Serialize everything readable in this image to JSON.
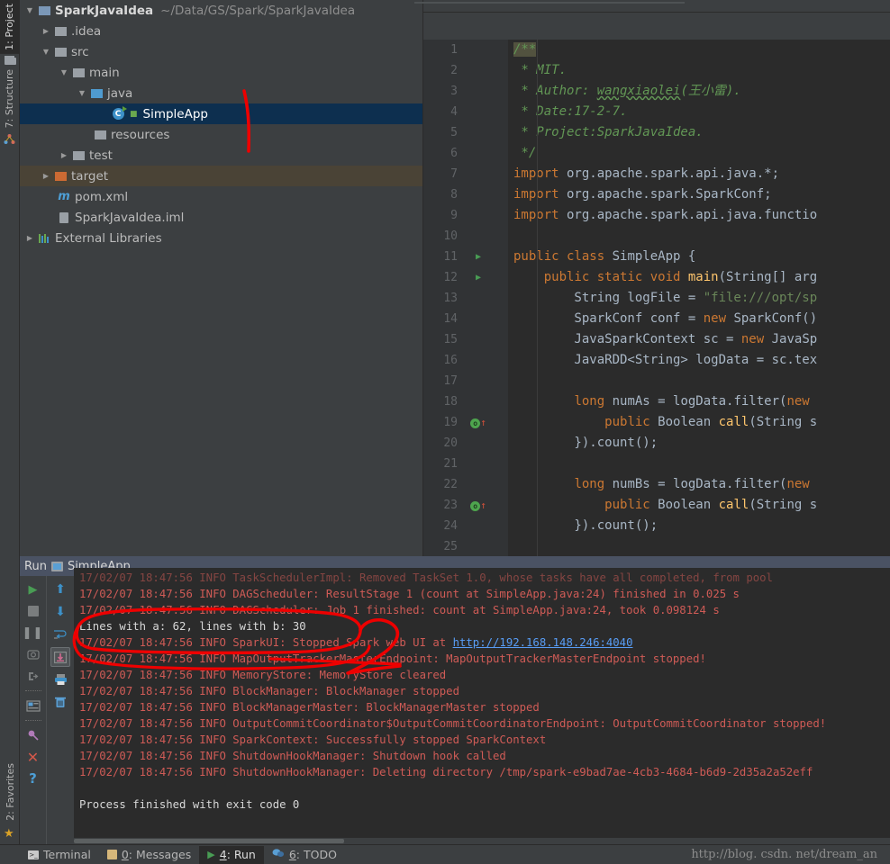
{
  "toolwindows": {
    "left": [
      {
        "label": "1: Project",
        "prefix": "1",
        "icon": "project-icon",
        "active": true
      },
      {
        "label": "7: Structure",
        "prefix": "7",
        "icon": "structure-icon",
        "active": false
      },
      {
        "label": "2: Favorites",
        "prefix": "2",
        "icon": "star-icon",
        "active": false
      }
    ]
  },
  "project_tree": {
    "root": {
      "name": "SparkJavaIdea",
      "path": "~/Data/GS/Spark/SparkJavaIdea"
    },
    "rows": [
      {
        "label": "SparkJavaIdea",
        "detail": "~/Data/GS/Spark/SparkJavaIdea",
        "depth": 0,
        "arrow": "down",
        "icon": "module-folder-icon",
        "state": "normal"
      },
      {
        "label": ".idea",
        "detail": "",
        "depth": 1,
        "arrow": "right",
        "icon": "folder-icon",
        "state": "normal"
      },
      {
        "label": "src",
        "detail": "",
        "depth": 1,
        "arrow": "down",
        "icon": "folder-icon",
        "state": "normal"
      },
      {
        "label": "main",
        "detail": "",
        "depth": 2,
        "arrow": "down",
        "icon": "folder-icon",
        "state": "normal"
      },
      {
        "label": "java",
        "detail": "",
        "depth": 3,
        "arrow": "down",
        "icon": "source-folder-icon",
        "state": "normal"
      },
      {
        "label": "SimpleApp",
        "detail": "",
        "depth": 4,
        "arrow": "none",
        "icon": "java-class-icon",
        "state": "selected"
      },
      {
        "label": "resources",
        "detail": "",
        "depth": 3,
        "arrow": "none",
        "icon": "resources-folder-icon",
        "state": "normal"
      },
      {
        "label": "test",
        "detail": "",
        "depth": 2,
        "arrow": "right",
        "icon": "folder-icon",
        "state": "normal"
      },
      {
        "label": "target",
        "detail": "",
        "depth": 1,
        "arrow": "right",
        "icon": "excluded-folder-icon",
        "state": "highlight"
      },
      {
        "label": "pom.xml",
        "detail": "",
        "depth": 1,
        "arrow": "none",
        "icon": "maven-icon",
        "state": "normal"
      },
      {
        "label": "SparkJavaIdea.iml",
        "detail": "",
        "depth": 1,
        "arrow": "none",
        "icon": "iml-icon",
        "state": "normal"
      },
      {
        "label": "External Libraries",
        "detail": "",
        "depth": 0,
        "arrow": "right",
        "icon": "libraries-icon",
        "state": "normal"
      }
    ]
  },
  "editor": {
    "lines": [
      {
        "n": "1",
        "fold": "top",
        "gutter": "",
        "segments": [
          {
            "t": "/**",
            "c": "c-cmt-hl"
          }
        ]
      },
      {
        "n": "2",
        "fold": "",
        "gutter": "",
        "segments": [
          {
            "t": " * MIT.",
            "c": "c-cmt"
          }
        ]
      },
      {
        "n": "3",
        "fold": "",
        "gutter": "",
        "segments": [
          {
            "t": " * Author: ",
            "c": "c-cmt"
          },
          {
            "t": "wangxiaolei",
            "c": "c-cmt-u"
          },
          {
            "t": "(王小雷).",
            "c": "c-cmt"
          }
        ]
      },
      {
        "n": "4",
        "fold": "",
        "gutter": "",
        "segments": [
          {
            "t": " * Date:17-2-7.",
            "c": "c-cmt"
          }
        ]
      },
      {
        "n": "5",
        "fold": "",
        "gutter": "",
        "segments": [
          {
            "t": " * Project:SparkJavaIdea.",
            "c": "c-cmt"
          }
        ]
      },
      {
        "n": "6",
        "fold": "end",
        "gutter": "",
        "segments": [
          {
            "t": " */",
            "c": "c-cmt"
          }
        ]
      },
      {
        "n": "7",
        "fold": "top",
        "gutter": "",
        "segments": [
          {
            "t": "import",
            "c": "c-kw"
          },
          {
            "t": " org.apache.spark.api.java.*;",
            "c": "c-txt"
          }
        ]
      },
      {
        "n": "8",
        "fold": "",
        "gutter": "",
        "segments": [
          {
            "t": "import",
            "c": "c-kw"
          },
          {
            "t": " org.apache.spark.SparkConf;",
            "c": "c-txt"
          }
        ]
      },
      {
        "n": "9",
        "fold": "end",
        "gutter": "",
        "segments": [
          {
            "t": "import",
            "c": "c-kw"
          },
          {
            "t": " org.apache.spark.api.java.functio",
            "c": "c-txt"
          }
        ]
      },
      {
        "n": "10",
        "fold": "",
        "gutter": "",
        "segments": [
          {
            "t": "",
            "c": "c-txt"
          }
        ]
      },
      {
        "n": "11",
        "fold": "",
        "gutter": "run",
        "segments": [
          {
            "t": "public class",
            "c": "c-kw"
          },
          {
            "t": " SimpleApp {",
            "c": "c-txt"
          }
        ]
      },
      {
        "n": "12",
        "fold": "top",
        "gutter": "run",
        "segments": [
          {
            "t": "    ",
            "c": "c-txt"
          },
          {
            "t": "public static void",
            "c": "c-kw"
          },
          {
            "t": " ",
            "c": "c-txt"
          },
          {
            "t": "main",
            "c": "c-meth"
          },
          {
            "t": "(String[] arg",
            "c": "c-txt"
          }
        ]
      },
      {
        "n": "13",
        "fold": "",
        "gutter": "",
        "segments": [
          {
            "t": "        String logFile = ",
            "c": "c-txt"
          },
          {
            "t": "\"file:///opt/sp",
            "c": "c-str"
          }
        ]
      },
      {
        "n": "14",
        "fold": "",
        "gutter": "",
        "segments": [
          {
            "t": "        SparkConf conf = ",
            "c": "c-txt"
          },
          {
            "t": "new",
            "c": "c-kw"
          },
          {
            "t": " SparkConf()",
            "c": "c-txt"
          }
        ]
      },
      {
        "n": "15",
        "fold": "",
        "gutter": "",
        "segments": [
          {
            "t": "        JavaSparkContext sc = ",
            "c": "c-txt"
          },
          {
            "t": "new",
            "c": "c-kw"
          },
          {
            "t": " JavaSp",
            "c": "c-txt"
          }
        ]
      },
      {
        "n": "16",
        "fold": "",
        "gutter": "",
        "segments": [
          {
            "t": "        JavaRDD<String> logData = sc.tex",
            "c": "c-txt"
          }
        ]
      },
      {
        "n": "17",
        "fold": "",
        "gutter": "",
        "segments": [
          {
            "t": "",
            "c": "c-txt"
          }
        ]
      },
      {
        "n": "18",
        "fold": "top",
        "gutter": "",
        "segments": [
          {
            "t": "        ",
            "c": "c-txt"
          },
          {
            "t": "long",
            "c": "c-kw"
          },
          {
            "t": " numAs = logData.filter(",
            "c": "c-txt"
          },
          {
            "t": "new",
            "c": "c-kw"
          }
        ]
      },
      {
        "n": "19",
        "fold": "bar",
        "gutter": "override",
        "segments": [
          {
            "t": "            ",
            "c": "c-txt"
          },
          {
            "t": "public",
            "c": "c-kw"
          },
          {
            "t": " Boolean ",
            "c": "c-txt"
          },
          {
            "t": "call",
            "c": "c-meth"
          },
          {
            "t": "(String s",
            "c": "c-txt"
          }
        ]
      },
      {
        "n": "20",
        "fold": "end",
        "gutter": "",
        "segments": [
          {
            "t": "        }).count();",
            "c": "c-txt"
          }
        ]
      },
      {
        "n": "21",
        "fold": "",
        "gutter": "",
        "segments": [
          {
            "t": "",
            "c": "c-txt"
          }
        ]
      },
      {
        "n": "22",
        "fold": "top",
        "gutter": "",
        "segments": [
          {
            "t": "        ",
            "c": "c-txt"
          },
          {
            "t": "long",
            "c": "c-kw"
          },
          {
            "t": " numBs = logData.filter(",
            "c": "c-txt"
          },
          {
            "t": "new",
            "c": "c-kw"
          }
        ]
      },
      {
        "n": "23",
        "fold": "bar",
        "gutter": "override",
        "segments": [
          {
            "t": "            ",
            "c": "c-txt"
          },
          {
            "t": "public",
            "c": "c-kw"
          },
          {
            "t": " Boolean ",
            "c": "c-txt"
          },
          {
            "t": "call",
            "c": "c-meth"
          },
          {
            "t": "(String s",
            "c": "c-txt"
          }
        ]
      },
      {
        "n": "24",
        "fold": "end",
        "gutter": "",
        "segments": [
          {
            "t": "        }).count();",
            "c": "c-txt"
          }
        ]
      },
      {
        "n": "25",
        "fold": "",
        "gutter": "",
        "segments": [
          {
            "t": "",
            "c": "c-txt"
          }
        ]
      }
    ]
  },
  "run_panel": {
    "header_title": "Run",
    "header_config": "SimpleApp",
    "toolbar_left": [
      "rerun-icon",
      "stop-icon",
      "pause-icon",
      "dump-threads-icon",
      "resume-icon",
      "toggle-view-icon",
      "pin-icon",
      "close-icon",
      "help-icon"
    ],
    "toolbar_right": [
      "up-icon",
      "down-icon",
      "soft-wrap-icon",
      "scroll-to-end-icon",
      "print-icon",
      "clear-all-icon"
    ],
    "console_lines": [
      {
        "text": "17/02/07 18:47:56 INFO TaskSchedulerImpl: Removed TaskSet 1.0, whose tasks have all completed, from pool",
        "type": "clipped"
      },
      {
        "text": "17/02/07 18:47:56 INFO DAGScheduler: ResultStage 1 (count at SimpleApp.java:24) finished in 0.025 s",
        "type": "err"
      },
      {
        "text": "17/02/07 18:47:56 INFO DAGScheduler: Job 1 finished: count at SimpleApp.java:24, took 0.098124 s",
        "type": "err"
      },
      {
        "text": "Lines with a: 62, lines with b: 30",
        "type": "out"
      },
      {
        "text": "17/02/07 18:47:56 INFO SparkUI: Stopped Spark web UI at ",
        "type": "err",
        "link": "http://192.168.148.246:4040"
      },
      {
        "text": "17/02/07 18:47:56 INFO MapOutputTrackerMasterEndpoint: MapOutputTrackerMasterEndpoint stopped!",
        "type": "err"
      },
      {
        "text": "17/02/07 18:47:56 INFO MemoryStore: MemoryStore cleared",
        "type": "err"
      },
      {
        "text": "17/02/07 18:47:56 INFO BlockManager: BlockManager stopped",
        "type": "err"
      },
      {
        "text": "17/02/07 18:47:56 INFO BlockManagerMaster: BlockManagerMaster stopped",
        "type": "err"
      },
      {
        "text": "17/02/07 18:47:56 INFO OutputCommitCoordinator$OutputCommitCoordinatorEndpoint: OutputCommitCoordinator stopped!",
        "type": "err"
      },
      {
        "text": "17/02/07 18:47:56 INFO SparkContext: Successfully stopped SparkContext",
        "type": "err"
      },
      {
        "text": "17/02/07 18:47:56 INFO ShutdownHookManager: Shutdown hook called",
        "type": "err"
      },
      {
        "text": "17/02/07 18:47:56 INFO ShutdownHookManager: Deleting directory /tmp/spark-e9bad7ae-4cb3-4684-b6d9-2d35a2a52eff",
        "type": "err"
      },
      {
        "text": "",
        "type": "err"
      },
      {
        "text": "Process finished with exit code 0",
        "type": "out"
      }
    ]
  },
  "statusbar": {
    "items": [
      {
        "label": "Terminal",
        "num": "",
        "icon": "terminal-icon",
        "active": false
      },
      {
        "label": ": Messages",
        "num": "0",
        "icon": "messages-icon",
        "active": false
      },
      {
        "label": ": Run",
        "num": "4",
        "icon": "run-icon",
        "active": true
      },
      {
        "label": ": TODO",
        "num": "6",
        "icon": "todo-icon",
        "active": false
      }
    ],
    "watermark": "http://blog. csdn. net/dream_an"
  },
  "colors": {
    "selection_blue": "#0d2f4f",
    "excluded_olive": "#4a4336",
    "annotation_red": "#ee0000",
    "run_header": "#4a5263",
    "console_error": "#cf5b56",
    "link_blue": "#589df6"
  }
}
